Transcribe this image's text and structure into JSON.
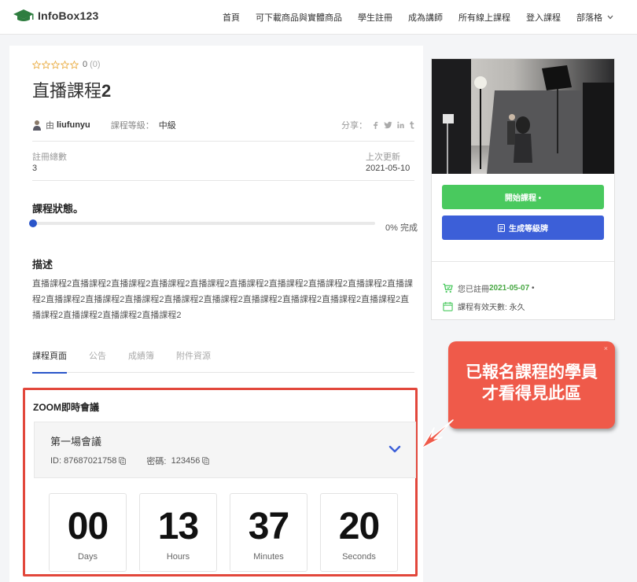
{
  "header": {
    "logo_text": "InfoBox123",
    "nav": [
      "首頁",
      "可下載商品與實體商品",
      "學生註冊",
      "成為講師",
      "所有線上課程",
      "登入課程",
      "部落格"
    ]
  },
  "course": {
    "rating_value": "0",
    "rating_count": "(0)",
    "title_prefix": "直播課程",
    "title_suffix": "2",
    "by_label": "由",
    "author": "liufunyu",
    "level_label": "課程等級：",
    "level": "中級",
    "share_label": "分享：",
    "enrolled_label": "註冊總數",
    "enrolled_value": "3",
    "updated_label": "上次更新",
    "updated_value": "2021-05-10",
    "status_heading": "課程狀態。",
    "progress_percent": 0,
    "progress_text": "0% 完成",
    "desc_heading": "描述",
    "description": "直播課程2直播課程2直播課程2直播課程2直播課程2直播課程2直播課程2直播課程2直播課程2直播課程2直播課程2直播課程2直播課程2直播課程2直播課程2直播課程2直播課程2直播課程2直播課程2直播課程2直播課程2直播課程2直播課程2"
  },
  "tabs": [
    "課程頁面",
    "公告",
    "成績簿",
    "附件資源"
  ],
  "zoom": {
    "title": "ZOOM即時會議",
    "meeting_name": "第一場會議",
    "id_label": "ID:",
    "id_value": "87687021758",
    "pwd_label": "密碼:",
    "pwd_value": "123456",
    "countdown": [
      {
        "value": "00",
        "label": "Days"
      },
      {
        "value": "13",
        "label": "Hours"
      },
      {
        "value": "37",
        "label": "Minutes"
      },
      {
        "value": "20",
        "label": "Seconds"
      }
    ]
  },
  "sidebar": {
    "start_button": "開始課程 •",
    "cert_button": "生成等級牌",
    "enroll_prefix": "您已註冊",
    "enroll_date": "2021-05-07",
    "enroll_suffix": "•",
    "valid_text": "課程有效天數: 永久"
  },
  "callout": {
    "text": "已報名課程的學員才看得見此區",
    "close": "×"
  },
  "colors": {
    "accent_blue": "#3c5fd8",
    "accent_green": "#49c95e",
    "highlight_red": "#e2473b",
    "callout_red": "#ef5a4a"
  }
}
